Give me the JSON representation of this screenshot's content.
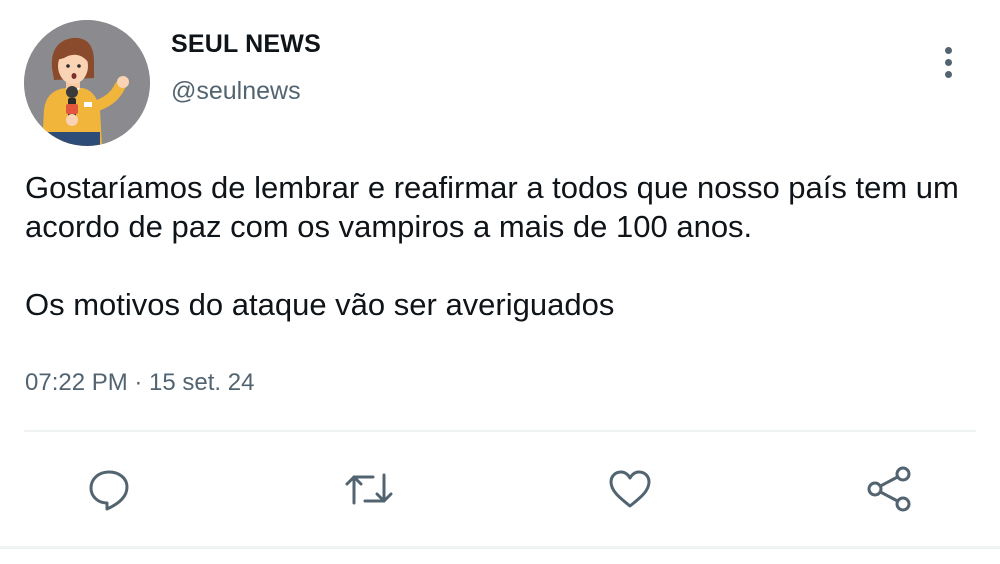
{
  "author": {
    "name": "SEUL NEWS",
    "handle": "@seulnews",
    "avatar_icon": "news-reporter-avatar"
  },
  "menu": {
    "icon": "more-vertical-icon"
  },
  "tweet": {
    "paragraphs": [
      "Gostaríamos de lembrar e reafirmar a todos que nosso país tem um acordo de paz com os vampiros a mais de 100 anos.",
      "Os motivos do ataque vão ser averiguados"
    ],
    "timestamp": "07:22 PM · 15 set. 24"
  },
  "actions": {
    "reply_icon": "reply-icon",
    "retweet_icon": "retweet-icon",
    "like_icon": "like-icon",
    "share_icon": "share-icon"
  },
  "colors": {
    "text": "#0f1419",
    "secondary": "#536471",
    "divider": "#eff3f4",
    "avatar_bg": "#8b8b8f",
    "reporter_shirt": "#f2b53b"
  }
}
